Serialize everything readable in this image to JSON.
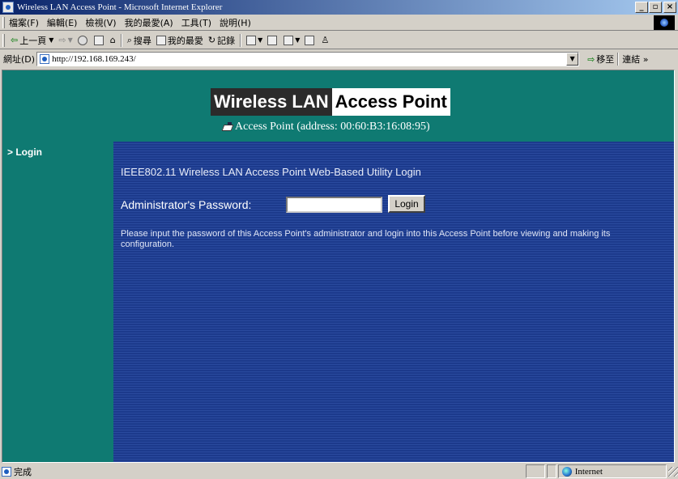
{
  "window": {
    "title": "Wireless LAN Access Point - Microsoft Internet Explorer",
    "controls": {
      "minimize": "_",
      "maximize": "̧",
      "close": "×"
    }
  },
  "menubar": {
    "items": [
      "檔案(F)",
      "編輯(E)",
      "檢視(V)",
      "我的最愛(A)",
      "工具(T)",
      "說明(H)"
    ]
  },
  "toolbar": {
    "back": "上一頁",
    "search": "搜尋",
    "favorites": "我的最愛",
    "history": "記錄"
  },
  "addressbar": {
    "label": "網址(D)",
    "url": "http://192.168.169.243/",
    "go": "移至",
    "links": "連結 »"
  },
  "page": {
    "brand_part1": "Wireless LAN",
    "brand_part2": "Access Point",
    "subtitle": "Access Point (address: 00:60:B3:16:08:95)",
    "nav_login": "> Login",
    "utility_title": "IEEE802.11 Wireless LAN Access Point Web-Based Utility Login",
    "password_label": "Administrator's Password:",
    "password_value": "",
    "login_button": "Login",
    "help_text": "Please input the password of this Access Point's administrator and login into this Access Point before viewing and making its configuration."
  },
  "statusbar": {
    "status": "完成",
    "zone": "Internet"
  },
  "colors": {
    "teal_background": "#0f7a72",
    "main_blue": "#1c3a8c",
    "titlebar_start": "#0a246a"
  }
}
